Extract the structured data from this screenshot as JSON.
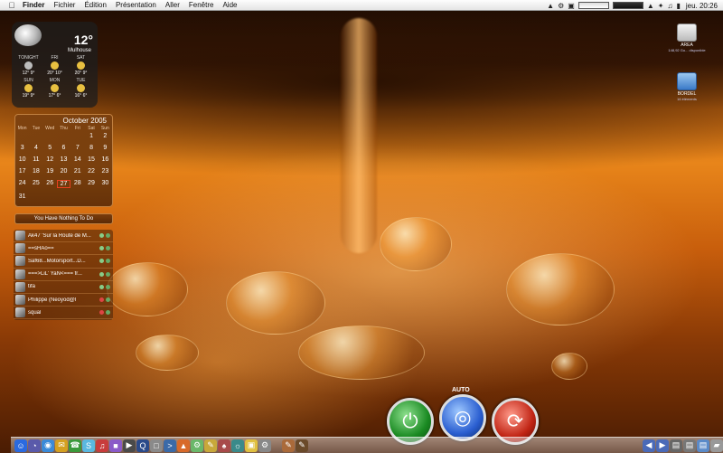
{
  "menubar": {
    "apple_icon": "apple-icon",
    "items": [
      "Finder",
      "Fichier",
      "Édition",
      "Présentation",
      "Aller",
      "Fenêtre",
      "Aide"
    ],
    "clock": "jeu. 20:26"
  },
  "weather": {
    "temp": "12°",
    "city": "Mulhouse",
    "days": [
      {
        "day": "TONIGHT",
        "icon": "moon",
        "hilo": "12° 9°"
      },
      {
        "day": "FRI",
        "icon": "sun",
        "hilo": "20° 10°"
      },
      {
        "day": "SAT",
        "icon": "sun",
        "hilo": "20° 9°"
      },
      {
        "day": "SUN",
        "icon": "sun",
        "hilo": "19° 9°"
      },
      {
        "day": "MON",
        "icon": "sun",
        "hilo": "17° 6°"
      },
      {
        "day": "TUE",
        "icon": "sun",
        "hilo": "16° 6°"
      }
    ]
  },
  "calendar": {
    "title": "October 2005",
    "dows": [
      "Mon",
      "Tue",
      "Wed",
      "Thu",
      "Fri",
      "Sat",
      "Sun"
    ],
    "today": "27",
    "days": [
      "",
      "",
      "",
      "",
      "",
      "1",
      "2",
      "3",
      "4",
      "5",
      "6",
      "7",
      "8",
      "9",
      "10",
      "11",
      "12",
      "13",
      "14",
      "15",
      "16",
      "17",
      "18",
      "19",
      "20",
      "21",
      "22",
      "23",
      "24",
      "25",
      "26",
      "27",
      "28",
      "29",
      "30",
      "31",
      "",
      "",
      "",
      "",
      "",
      ""
    ]
  },
  "todo": {
    "label": "You Have Nothing To Do"
  },
  "buddies": [
    {
      "name": "Ak47 'Sur la Route de M...",
      "status": "green"
    },
    {
      "name": "==sHAo==",
      "status": "green"
    },
    {
      "name": "Saf68...Motorsport...D...",
      "status": "green"
    },
    {
      "name": "===>LiL' YaN<=== fr...",
      "status": "green"
    },
    {
      "name": "tifa",
      "status": "green"
    },
    {
      "name": "Philippe (Neoyod@l",
      "status": "red"
    },
    {
      "name": "squal",
      "status": "red"
    }
  ],
  "desktop_icons": [
    {
      "label": "AREA",
      "sub": "148,92 Go... disponible",
      "icon": "drive-icon"
    },
    {
      "label": "BORDEL",
      "sub": "16 éléments",
      "icon": "folder-icon"
    }
  ],
  "controls": {
    "auto_label": "AUTO"
  },
  "colors": {
    "accent": "#e8851a",
    "dock": "#cfcfcf"
  }
}
